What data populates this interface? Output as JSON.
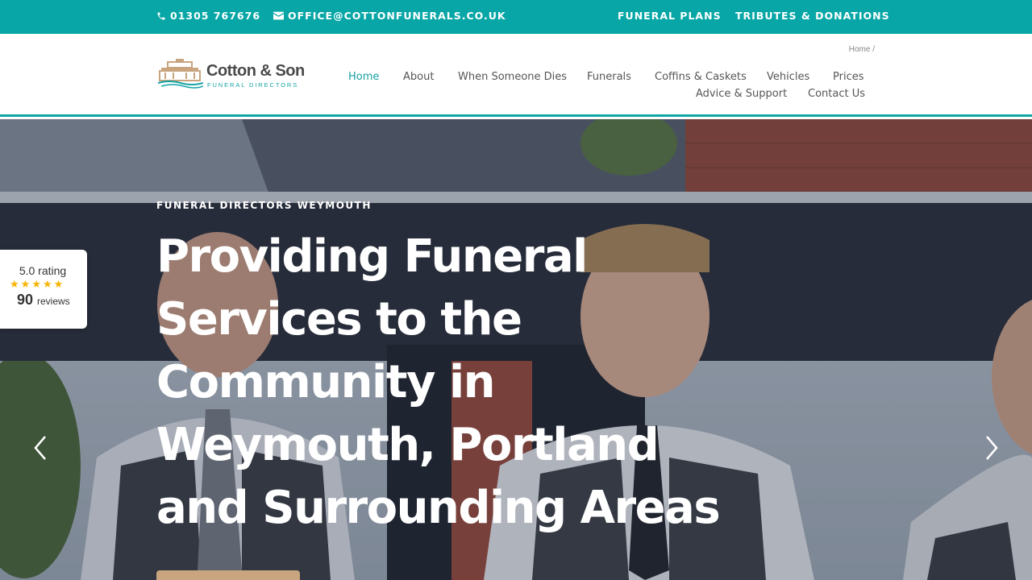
{
  "topbar": {
    "phone": "01305 767676",
    "email": "OFFICE@COTTONFUNERALS.CO.UK",
    "links": [
      "FUNERAL PLANS",
      "TRIBUTES & DONATIONS"
    ],
    "color": "#08a6a6"
  },
  "header": {
    "breadcrumb": "Home /",
    "logo": {
      "name": "Cotton & Son",
      "subtitle": "FUNERAL DIRECTORS"
    },
    "nav": [
      {
        "label": "Home",
        "active": true
      },
      {
        "label": "About"
      },
      {
        "label": "When Someone Dies"
      },
      {
        "label": "Funerals"
      },
      {
        "label": "Coffins & Caskets"
      },
      {
        "label": "Vehicles"
      },
      {
        "label": "Prices"
      },
      {
        "label": "Advice & Support"
      },
      {
        "label": "Contact Us"
      }
    ],
    "accent": "#18a0a3"
  },
  "hero": {
    "eyebrow": "FUNERAL DIRECTORS WEYMOUTH",
    "headline_lines": [
      "Providing Funeral",
      "Services to the",
      "Community in",
      "Weymouth, Portland",
      "and Surrounding Areas"
    ],
    "button_color": "#c8a57e",
    "prev_icon": "chevron-left-icon",
    "next_icon": "chevron-right-icon"
  },
  "rating_widget": {
    "rating_text": "5.0 rating",
    "stars": 5,
    "review_count": "90",
    "reviews_label": "reviews",
    "star_color": "#f5b400"
  }
}
